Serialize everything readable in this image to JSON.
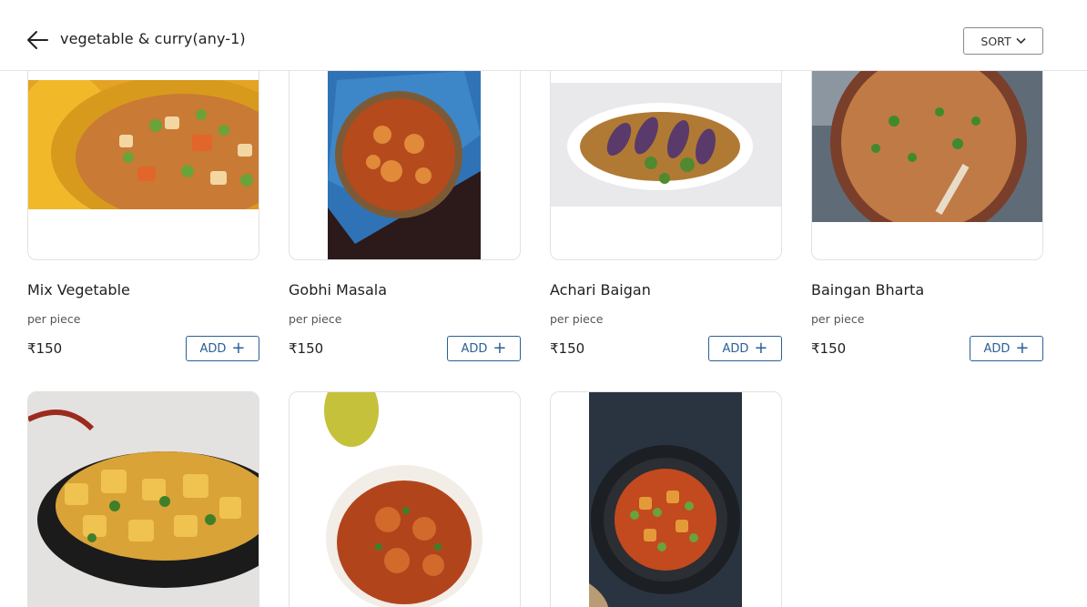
{
  "header": {
    "title": "vegetable & curry(any-1)",
    "sort_label": "SORT",
    "back_icon": "arrow-left-icon",
    "sort_icon": "chevron-down-icon"
  },
  "products": [
    {
      "name": "Mix Vegetable",
      "unit": "per piece",
      "price": "₹150",
      "add_label": "ADD"
    },
    {
      "name": "Gobhi Masala",
      "unit": "per piece",
      "price": "₹150",
      "add_label": "ADD"
    },
    {
      "name": "Achari Baigan",
      "unit": "per piece",
      "price": "₹150",
      "add_label": "ADD"
    },
    {
      "name": "Baingan Bharta",
      "unit": "per piece",
      "price": "₹150",
      "add_label": "ADD"
    },
    {
      "name": "",
      "unit": "",
      "price": "",
      "add_label": ""
    },
    {
      "name": "",
      "unit": "",
      "price": "",
      "add_label": ""
    },
    {
      "name": "",
      "unit": "",
      "price": "",
      "add_label": ""
    }
  ],
  "colors": {
    "accent": "#2b5f97",
    "border": "#e2e2e2"
  }
}
